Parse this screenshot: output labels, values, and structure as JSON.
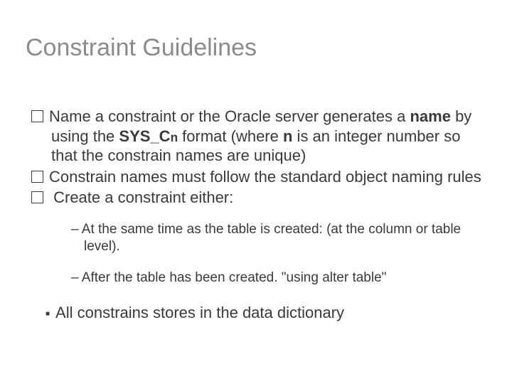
{
  "title": "Constraint Guidelines",
  "bullets": {
    "b1_pre": "Name a constraint or the Oracle server generates a ",
    "b1_bold1": "name",
    "b1_mid": " by using the ",
    "b1_sys": "SYS_C",
    "b1_sysn": "n",
    "b1_post1": " format (where ",
    "b1_boldn": "n",
    "b1_post2": " is an integer number so that the constrain names are unique)",
    "b2": "Constrain names must follow the standard object naming rules",
    "b3": " Create a constraint either:"
  },
  "subs": {
    "s1": "– At the same time as the table is created: (at the column or table level).",
    "s2": "– After the table has been created. \"using alter table\""
  },
  "final": "All constrains stores in the data dictionary"
}
